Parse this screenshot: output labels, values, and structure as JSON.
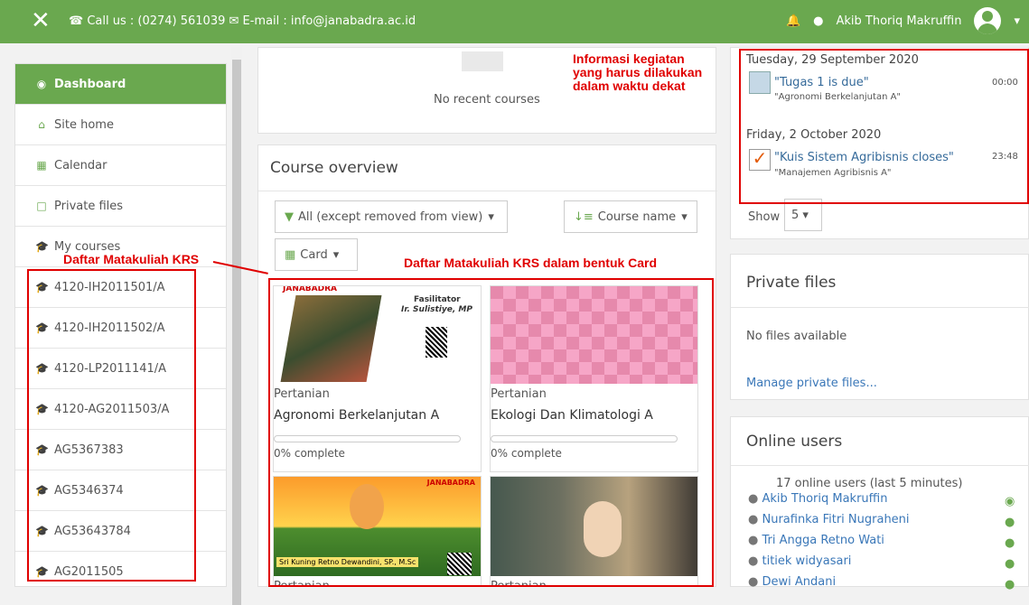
{
  "topbar": {
    "close": "✕",
    "contact": "☎ Call us : (0274) 561039 ✉ E-mail : info@janabadra.ac.id",
    "user": "Akib Thoriq Makruffin"
  },
  "sidebar": {
    "items": [
      {
        "label": "Dashboard",
        "icon": "dashboard-icon"
      },
      {
        "label": "Site home",
        "icon": "home-icon"
      },
      {
        "label": "Calendar",
        "icon": "calendar-icon"
      },
      {
        "label": "Private files",
        "icon": "file-icon"
      },
      {
        "label": "My courses",
        "icon": "graduation-cap-icon"
      },
      {
        "label": "4120-IH2011501/A",
        "icon": "graduation-cap-icon"
      },
      {
        "label": "4120-IH2011502/A",
        "icon": "graduation-cap-icon"
      },
      {
        "label": "4120-LP2011141/A",
        "icon": "graduation-cap-icon"
      },
      {
        "label": "4120-AG2011503/A",
        "icon": "graduation-cap-icon"
      },
      {
        "label": "AG5367383",
        "icon": "graduation-cap-icon"
      },
      {
        "label": "AG5346374",
        "icon": "graduation-cap-icon"
      },
      {
        "label": "AG53643784",
        "icon": "graduation-cap-icon"
      },
      {
        "label": "AG2011505",
        "icon": "graduation-cap-icon"
      }
    ]
  },
  "annotations": {
    "sidebar": "Daftar Matakuliah KRS",
    "cards": "Daftar Matakuliah KRS dalam bentuk Card",
    "timeline": "Informasi kegiatan\nyang harus dilakukan\ndalam waktu dekat"
  },
  "recent": {
    "empty": "No recent courses"
  },
  "overview": {
    "title": "Course overview",
    "filter": "All (except removed from view)",
    "sort": "Course name",
    "view": "Card"
  },
  "cards": [
    {
      "category": "Pertanian",
      "name": "Agronomi Berkelanjutan A",
      "progress": "0% complete",
      "facilitator": "Fasilitator",
      "lecturer": "Ir. Sulistiye, MP",
      "brand": "JANABADRA"
    },
    {
      "category": "Pertanian",
      "name": "Ekologi Dan Klimatologi A",
      "progress": "0% complete"
    },
    {
      "caption": "Sri Kuning Retno Dewandini, SP., M.Sc",
      "brand": "JANABADRA",
      "category": "Pertanian"
    },
    {
      "category": "Pertanian"
    }
  ],
  "timeline": {
    "groups": [
      {
        "date": "Tuesday, 29 September 2020",
        "event": "\"Tugas 1 is due\"",
        "course": "\"Agronomi Berkelanjutan A\"",
        "time": "00:00"
      },
      {
        "date": "Friday, 2 October 2020",
        "event": "\"Kuis Sistem Agribisnis closes\"",
        "course": "\"Manajemen Agribisnis A\"",
        "time": "23:48"
      }
    ],
    "show": "Show",
    "count": "5"
  },
  "private": {
    "title": "Private files",
    "empty": "No files available",
    "manage": "Manage private files..."
  },
  "online": {
    "title": "Online users",
    "summary": "17 online users (last 5 minutes)",
    "users": [
      "Akib Thoriq Makruffin",
      "Nurafinka Fitri Nugraheni",
      "Tri Angga Retno Wati",
      "titiek widyasari",
      "Dewi Andani"
    ]
  }
}
